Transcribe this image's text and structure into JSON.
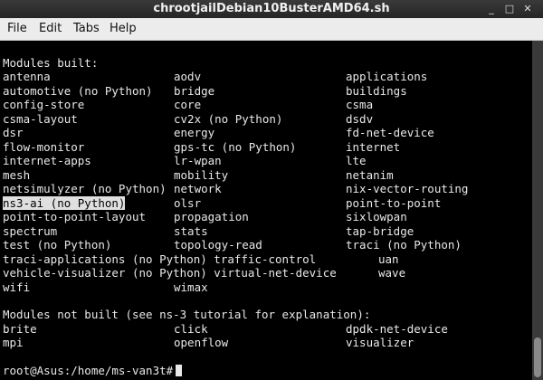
{
  "window": {
    "title": "chrootjailDebian10BusterAMD64.sh",
    "min_glyph": "_",
    "max_glyph": "□",
    "close_glyph": "✕"
  },
  "menu": [
    "File",
    "Edit",
    "Tabs",
    "Help"
  ],
  "terminal": {
    "built_header": "Modules built:",
    "built": [
      [
        "antenna",
        "aodv",
        "applications"
      ],
      [
        "automotive (no Python)",
        "bridge",
        "buildings"
      ],
      [
        "config-store",
        "core",
        "csma"
      ],
      [
        "csma-layout",
        "cv2x (no Python)",
        "dsdv"
      ],
      [
        "dsr",
        "energy",
        "fd-net-device"
      ],
      [
        "flow-monitor",
        "gps-tc (no Python)",
        "internet"
      ],
      [
        "internet-apps",
        "lr-wpan",
        "lte"
      ],
      [
        "mesh",
        "mobility",
        "netanim"
      ],
      [
        "netsimulyzer (no Python)",
        "network",
        "nix-vector-routing"
      ],
      [
        "ns3-ai (no Python)",
        "olsr",
        "point-to-point"
      ],
      [
        "point-to-point-layout",
        "propagation",
        "sixlowpan"
      ],
      [
        "spectrum",
        "stats",
        "tap-bridge"
      ],
      [
        "test (no Python)",
        "topology-read",
        "traci (no Python)"
      ],
      [
        "traci-applications (no Python) traffic-control",
        "",
        "uan"
      ],
      [
        "vehicle-visualizer (no Python) virtual-net-device",
        "",
        "wave"
      ],
      [
        "wifi",
        "wimax",
        ""
      ]
    ],
    "not_built_header": "Modules not built (see ns-3 tutorial for explanation):",
    "not_built": [
      [
        "brite",
        "click",
        "dpdk-net-device"
      ],
      [
        "mpi",
        "openflow",
        "visualizer"
      ]
    ],
    "prompt": "root@Asus:/home/ms-van3t#"
  },
  "colors": {
    "background": "#000000",
    "text": "#e8e8e8",
    "highlight": "#e0e0e0"
  }
}
